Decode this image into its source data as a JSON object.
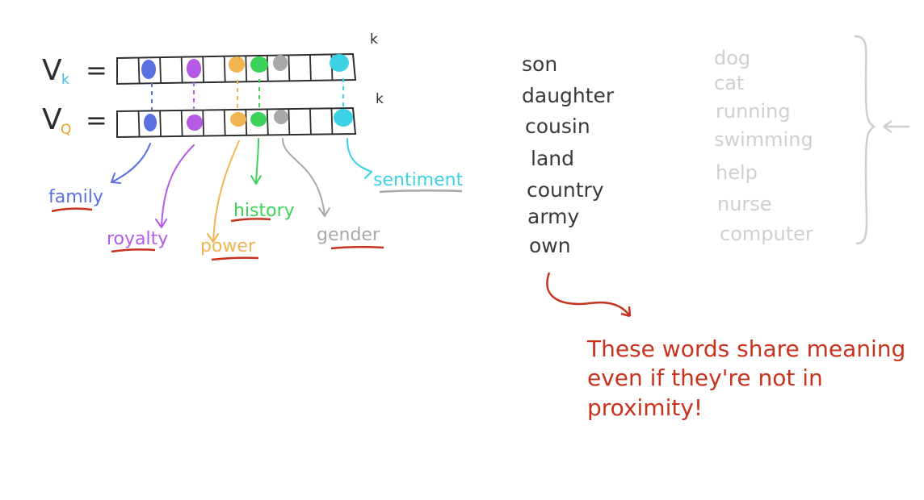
{
  "vectors": [
    {
      "symbol": "V",
      "subscript": "k",
      "subscript_color": "#3fb8e8",
      "equals": "=",
      "superscript": "k"
    },
    {
      "symbol": "V",
      "subscript": "Q",
      "subscript_color": "#f0a020",
      "equals": "=",
      "superscript": "k"
    }
  ],
  "features": [
    {
      "label": "family",
      "color": "#5a6fe0",
      "underline_color": "#c8321e"
    },
    {
      "label": "royalty",
      "color": "#b45ae6",
      "underline_color": "#c8321e"
    },
    {
      "label": "power",
      "color": "#f0b450",
      "underline_color": "#c8321e"
    },
    {
      "label": "history",
      "color": "#3cd25a",
      "underline_color": "#c8321e"
    },
    {
      "label": "gender",
      "color": "#a8a8a8",
      "underline_color": "#c8321e"
    },
    {
      "label": "sentiment",
      "color": "#3cd2e6",
      "underline_color": "#a8a8a8"
    }
  ],
  "shared_words": [
    "son",
    "daughter",
    "cousin",
    "land",
    "country",
    "army",
    "own"
  ],
  "faded_words": [
    "dog",
    "cat",
    "running",
    "swimming",
    "help",
    "nurse",
    "computer"
  ],
  "note": {
    "lines": [
      "These words share meaning",
      "even if they're not in",
      "proximity!"
    ],
    "color": "#c8321e"
  },
  "colors": {
    "ink": "#3a3a3a",
    "faded_ink": "#cfcfcf"
  }
}
